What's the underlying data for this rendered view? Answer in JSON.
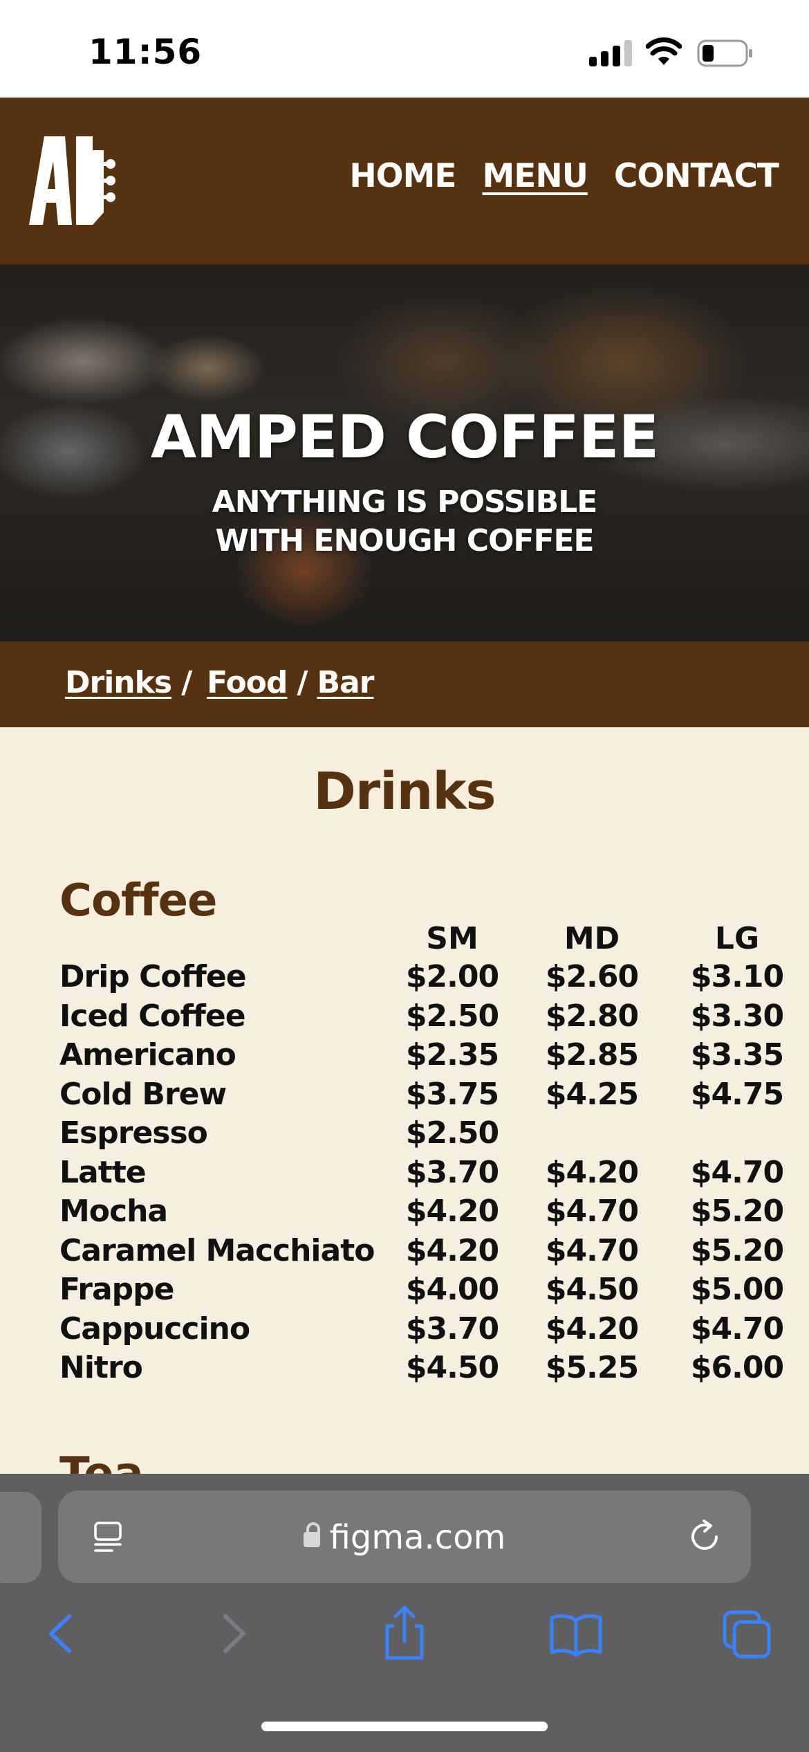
{
  "status_bar": {
    "time": "11:56"
  },
  "header": {
    "logo_text": "AI",
    "nav": [
      {
        "label": "HOME",
        "active": false
      },
      {
        "label": "MENU",
        "active": true
      },
      {
        "label": "CONTACT",
        "active": false
      }
    ]
  },
  "hero": {
    "title": "AMPED COFFEE",
    "subtitle_line1": "ANYTHING IS POSSIBLE",
    "subtitle_line2": "WITH ENOUGH COFFEE"
  },
  "section_nav": {
    "drinks": "Drinks",
    "food": "Food",
    "bar": "Bar",
    "separator": "/"
  },
  "menu": {
    "title": "Drinks",
    "category": "Coffee",
    "sizes": [
      "SM",
      "MD",
      "LG"
    ],
    "items": [
      {
        "name": "Drip Coffee",
        "prices": [
          "$2.00",
          "$2.60",
          "$3.10"
        ]
      },
      {
        "name": "Iced Coffee",
        "prices": [
          "$2.50",
          "$2.80",
          "$3.30"
        ]
      },
      {
        "name": "Americano",
        "prices": [
          "$2.35",
          "$2.85",
          "$3.35"
        ]
      },
      {
        "name": "Cold Brew",
        "prices": [
          "$3.75",
          "$4.25",
          "$4.75"
        ]
      },
      {
        "name": "Espresso",
        "prices": [
          "$2.50",
          "",
          ""
        ]
      },
      {
        "name": "Latte",
        "prices": [
          "$3.70",
          "$4.20",
          "$4.70"
        ]
      },
      {
        "name": "Mocha",
        "prices": [
          "$4.20",
          "$4.70",
          "$5.20"
        ]
      },
      {
        "name": "Caramel Macchiato",
        "prices": [
          "$4.20",
          "$4.70",
          "$5.20"
        ]
      },
      {
        "name": "Frappe",
        "prices": [
          "$4.00",
          "$4.50",
          "$5.00"
        ]
      },
      {
        "name": "Cappuccino",
        "prices": [
          "$3.70",
          "$4.20",
          "$4.70"
        ]
      },
      {
        "name": "Nitro",
        "prices": [
          "$4.50",
          "$5.25",
          "$6.00"
        ]
      }
    ],
    "next_category_partial": "Tea"
  },
  "browser": {
    "url": "figma.com"
  },
  "colors": {
    "brand_brown": "#573211",
    "cream": "#f6efdf",
    "ios_blue": "#3b82f6"
  }
}
